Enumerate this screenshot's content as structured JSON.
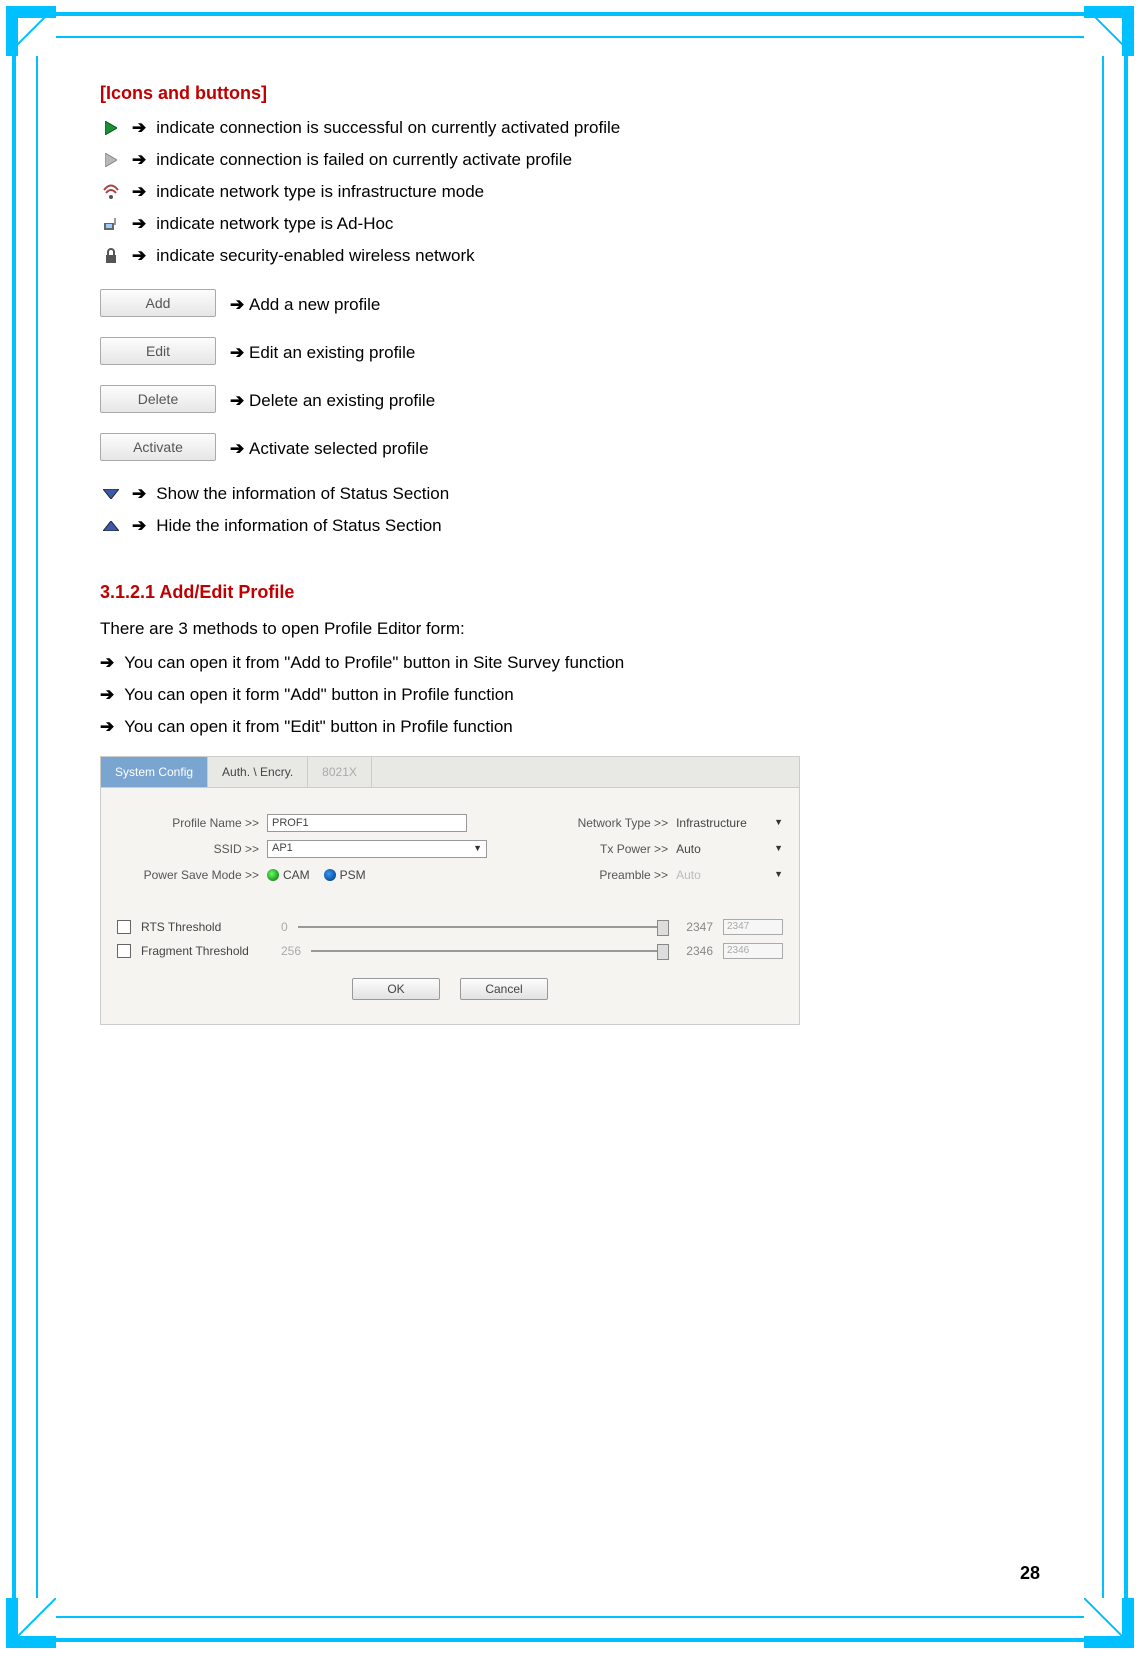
{
  "icons_section": {
    "title": "[Icons and buttons]",
    "items": [
      "indicate connection is successful on currently activated profile",
      "indicate connection is failed on currently activate profile",
      "indicate network type is infrastructure mode",
      "indicate network type is Ad-Hoc",
      "indicate security-enabled wireless network"
    ],
    "buttons": [
      {
        "label": "Add",
        "desc": "Add a new profile"
      },
      {
        "label": "Edit",
        "desc": "Edit an existing profile"
      },
      {
        "label": "Delete",
        "desc": "Delete an existing profile"
      },
      {
        "label": "Activate",
        "desc": "Activate selected profile"
      }
    ],
    "extras": [
      "Show the information of Status Section",
      "Hide the information of Status Section"
    ]
  },
  "subsection": {
    "heading": "3.1.2.1 Add/Edit Profile",
    "intro": "There are 3 methods to open Profile Editor form:",
    "methods": [
      "You can open it from \"Add to Profile\" button in Site Survey function",
      "You can open it form \"Add\" button in Profile function",
      "You can open it from \"Edit\" button in Profile function"
    ]
  },
  "editor": {
    "tabs": {
      "system": "System Config",
      "auth": "Auth. \\ Encry.",
      "dot1x": "8021X"
    },
    "labels": {
      "profile_name": "Profile Name >>",
      "ssid": "SSID >>",
      "power_save": "Power Save Mode >>",
      "cam": "CAM",
      "psm": "PSM",
      "network_type": "Network Type >>",
      "tx_power": "Tx Power >>",
      "preamble": "Preamble >>",
      "rts": "RTS Threshold",
      "frag": "Fragment Threshold",
      "ok": "OK",
      "cancel": "Cancel"
    },
    "values": {
      "profile_name": "PROF1",
      "ssid": "AP1",
      "network_type": "Infrastructure",
      "tx_power": "Auto",
      "preamble": "Auto",
      "rts_min": "0",
      "rts_val": "2347",
      "rts_box": "2347",
      "frag_min": "256",
      "frag_val": "2346",
      "frag_box": "2346"
    }
  },
  "arrow": "➔",
  "page_number": "28"
}
